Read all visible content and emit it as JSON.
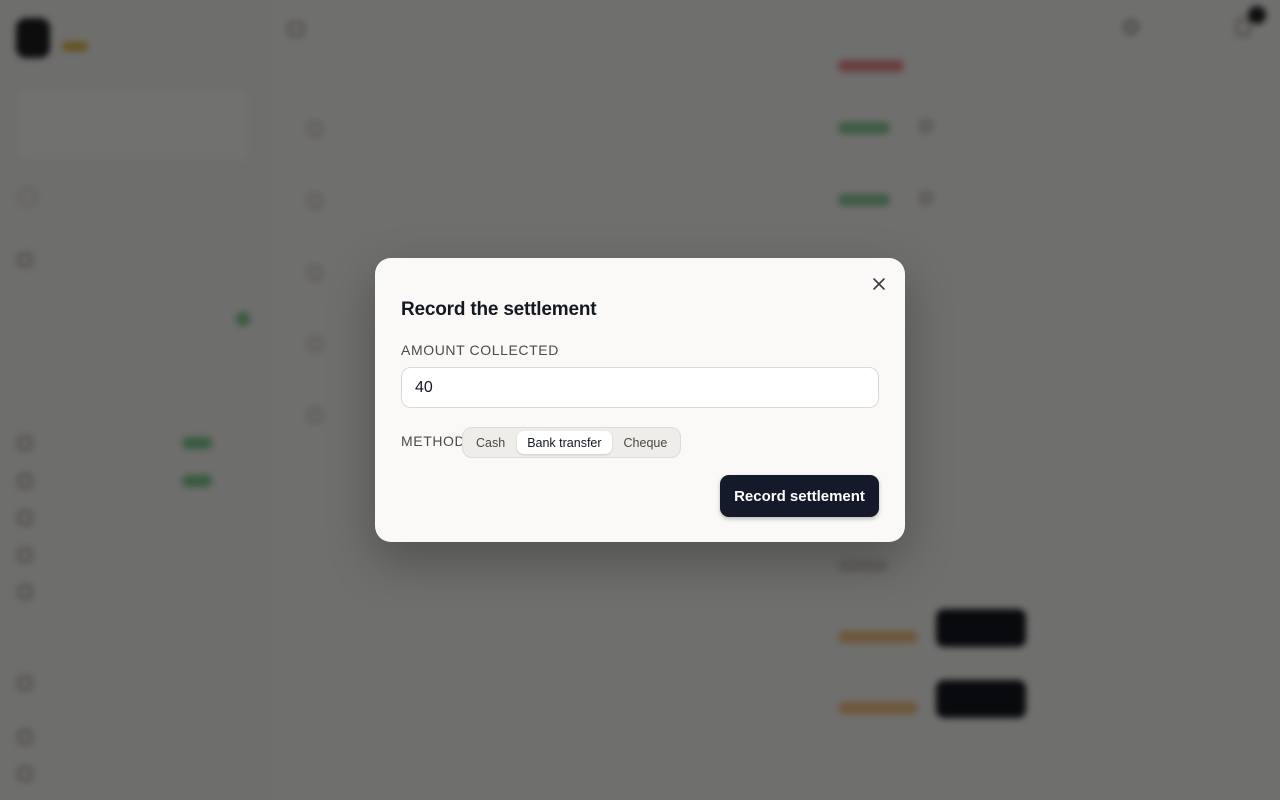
{
  "modal": {
    "title": "Record the settlement",
    "amount_label": "AMOUNT COLLECTED",
    "amount_value": "40",
    "method_label": "METHOD",
    "methods": [
      "Cash",
      "Bank transfer",
      "Cheque"
    ],
    "selected_method": "Bank transfer",
    "submit_label": "Record settlement",
    "close_icon": "close-icon"
  },
  "colors": {
    "overlay": "#000000",
    "modal_bg": "#faf9f7",
    "primary_button": "#141a2a"
  }
}
